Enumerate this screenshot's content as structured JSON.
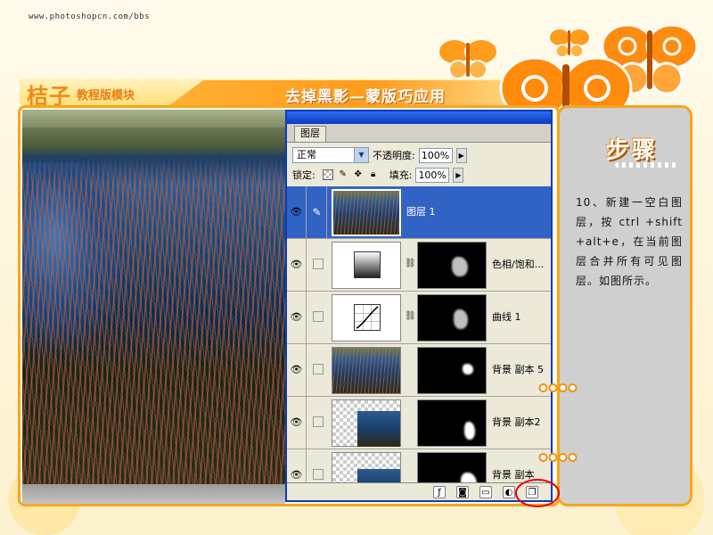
{
  "site_url": "www.photoshopcn.com/bbs",
  "brand": {
    "name": "桔子",
    "subtitle": "教程版模块"
  },
  "page_title": "去掉黑影—蒙版巧应用",
  "side_panel": {
    "heading": "步骤",
    "step_text": "10、新建一空白图 层，按 ctrl +shift+alt+e，在当前图层合并所有可见图层。如图所示。"
  },
  "layers_palette": {
    "tab_label": "图层",
    "blend_mode": "正常",
    "opacity_label": "不透明度:",
    "opacity_value": "100%",
    "lock_label": "锁定:",
    "fill_label": "填充:",
    "fill_value": "100%",
    "layers": [
      {
        "name": "图层 1",
        "selected": true,
        "thumb": "photo",
        "has_mask": false
      },
      {
        "name": "色相/饱和...",
        "selected": false,
        "thumb": "hue-sat-adjustment",
        "has_mask": true
      },
      {
        "name": "曲线 1",
        "selected": false,
        "thumb": "curves-adjustment",
        "has_mask": true
      },
      {
        "name": "背景 副本 5",
        "selected": false,
        "thumb": "photo",
        "has_mask": true
      },
      {
        "name": "背景 副本2",
        "selected": false,
        "thumb": "transparent-photo",
        "has_mask": true
      },
      {
        "name": "背景 副本",
        "selected": false,
        "thumb": "transparent-photo",
        "has_mask": true
      }
    ],
    "footer_icons": [
      "link-icon",
      "layer-style-icon",
      "add-mask-icon",
      "new-group-icon",
      "adjustment-layer-icon",
      "new-layer-icon"
    ]
  },
  "colors": {
    "accent_orange": "#f7a51e",
    "selection_blue": "#3163c5",
    "highlight_red": "#e00000"
  }
}
